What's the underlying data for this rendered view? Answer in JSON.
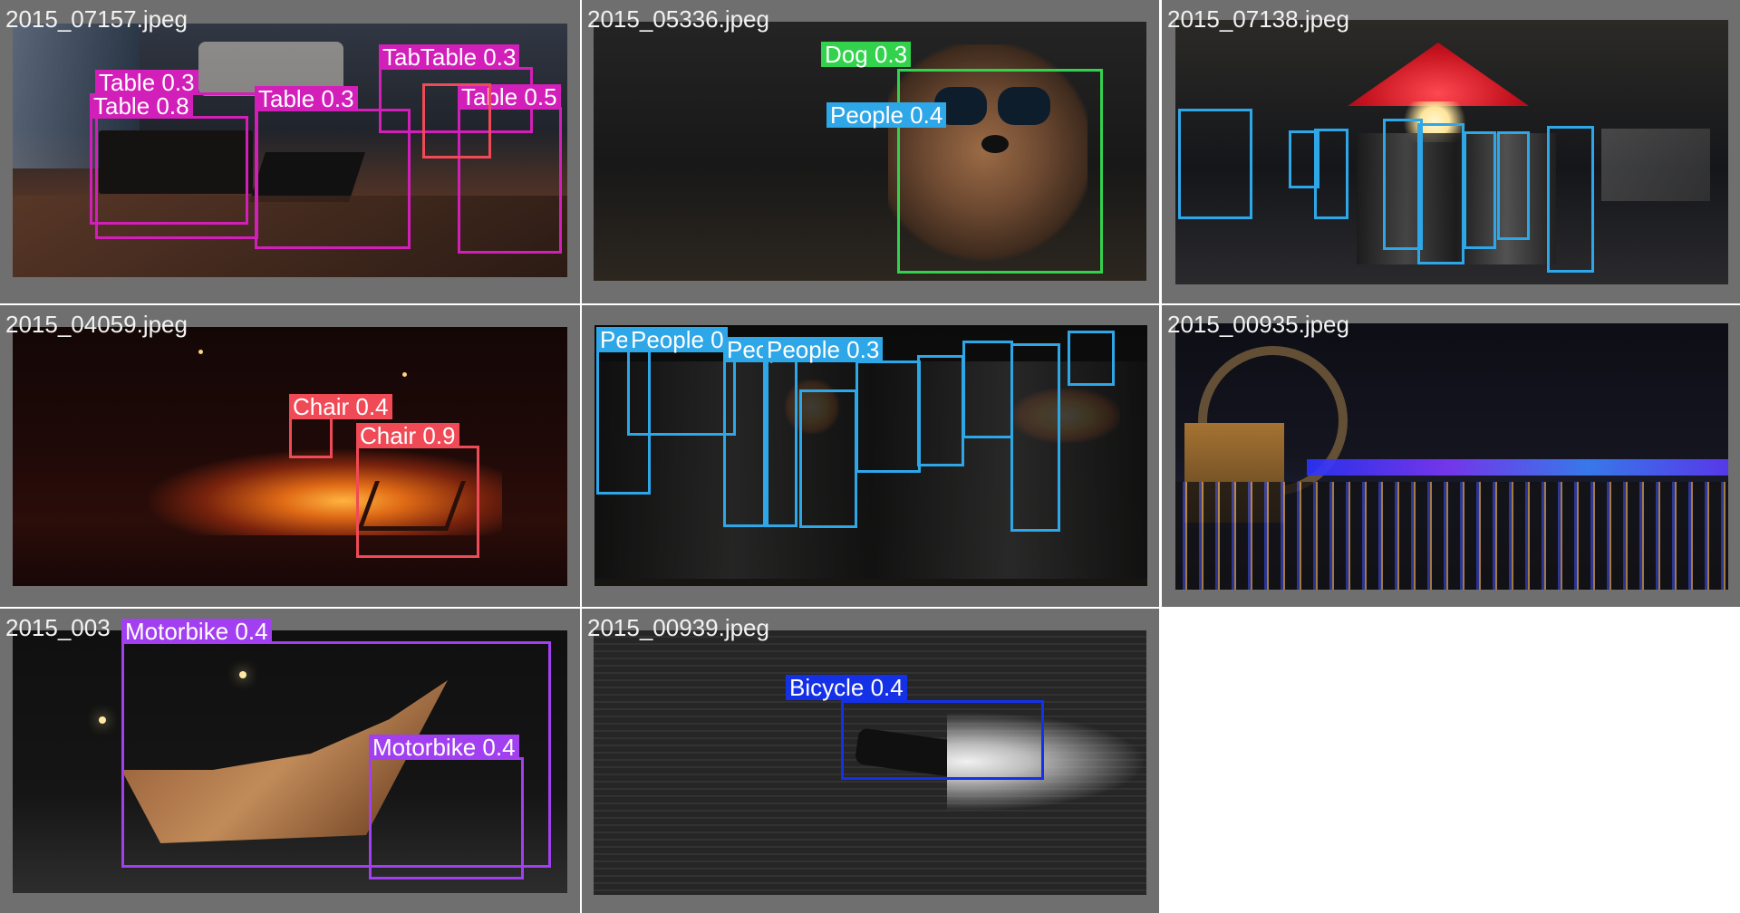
{
  "colors": {
    "table": "#d21fb9",
    "dog": "#33d24d",
    "people": "#2ea7e8",
    "chair": "#f04a56",
    "motorbike": "#a23ff0",
    "bicycle": "#1531e8"
  },
  "tiles": [
    {
      "filename": "2015_07157.jpeg",
      "boxes": [
        {
          "label": "Table 0.3",
          "class": "table"
        },
        {
          "label": "Table 0.8",
          "class": "table"
        },
        {
          "label": "Table 0.3",
          "class": "table"
        },
        {
          "label": "TabTable 0.3",
          "class": "table"
        },
        {
          "label": "Table 0.5",
          "class": "table"
        }
      ]
    },
    {
      "filename": "2015_05336.jpeg",
      "boxes": [
        {
          "label": "Dog 0.3",
          "class": "dog"
        },
        {
          "label": "People 0.4",
          "class": "people"
        }
      ]
    },
    {
      "filename": "2015_07138.jpeg",
      "boxes": [
        {
          "label": "",
          "class": "people"
        },
        {
          "label": "",
          "class": "people"
        },
        {
          "label": "",
          "class": "people"
        },
        {
          "label": "",
          "class": "people"
        },
        {
          "label": "",
          "class": "people"
        },
        {
          "label": "",
          "class": "people"
        },
        {
          "label": "",
          "class": "people"
        },
        {
          "label": "",
          "class": "people"
        }
      ]
    },
    {
      "filename": "2015_04059.jpeg",
      "boxes": [
        {
          "label": "Chair 0.4",
          "class": "chair"
        },
        {
          "label": "Chair 0.9",
          "class": "chair"
        }
      ]
    },
    {
      "filename": "",
      "boxes": [
        {
          "label": "Pe",
          "class": "people"
        },
        {
          "label": "People 0",
          "class": "people"
        },
        {
          "label": "Peop",
          "class": "people"
        },
        {
          "label": "People 0.3",
          "class": "people"
        },
        {
          "label": "",
          "class": "people"
        },
        {
          "label": "",
          "class": "people"
        },
        {
          "label": "",
          "class": "people"
        },
        {
          "label": "",
          "class": "people"
        },
        {
          "label": "",
          "class": "people"
        },
        {
          "label": "",
          "class": "people"
        }
      ]
    },
    {
      "filename": "2015_00935.jpeg",
      "boxes": []
    },
    {
      "filename": "2015_003",
      "boxes": [
        {
          "label": "Motorbike 0.4",
          "class": "motorbike"
        },
        {
          "label": "Motorbike 0.4",
          "class": "motorbike"
        }
      ]
    },
    {
      "filename": "2015_00939.jpeg",
      "boxes": [
        {
          "label": "Bicycle 0.4",
          "class": "bicycle"
        }
      ]
    }
  ]
}
